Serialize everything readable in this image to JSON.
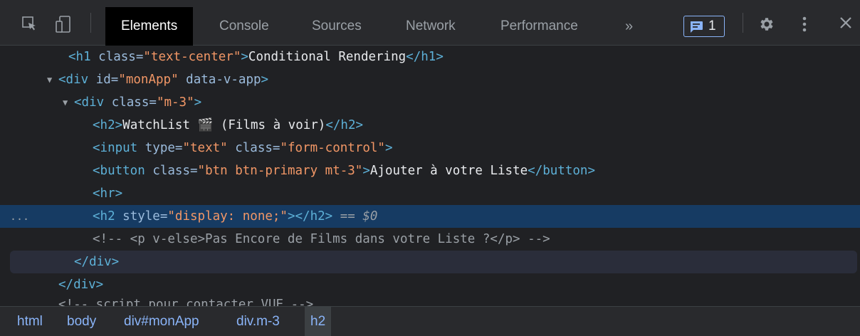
{
  "toolbar": {
    "tabs": [
      {
        "label": "Elements",
        "active": true
      },
      {
        "label": "Console",
        "active": false
      },
      {
        "label": "Sources",
        "active": false
      },
      {
        "label": "Network",
        "active": false
      },
      {
        "label": "Performance",
        "active": false
      }
    ],
    "more_tabs": "»",
    "issues_count": "1",
    "icons": [
      "inspect-element-icon",
      "device-toolbar-icon",
      "message-icon",
      "gear-icon",
      "kebab-menu-icon",
      "close-icon"
    ],
    "accent_color": "#8ab4f8"
  },
  "tree": {
    "h1_open": "<h1",
    "h1_attr": "class",
    "h1_val": "\"text-center\"",
    "h1_text": "Conditional Rendering",
    "h1_close": "</h1>",
    "div_app_open": "<div",
    "div_app_attr": "id",
    "div_app_val": "\"monApp\"",
    "div_app_attr2": "data-v-app",
    "div_m3_open": "<div",
    "div_m3_attr": "class",
    "div_m3_val": "\"m-3\"",
    "h2_open": "<h2>",
    "h2_text": "WatchList 🎬 (Films à voir)",
    "h2_close": "</h2>",
    "input_open": "<input",
    "input_attr1": "type",
    "input_val1": "\"text\"",
    "input_attr2": "class",
    "input_val2": "\"form-control\"",
    "button_open": "<button",
    "button_attr": "class",
    "button_val": "\"btn btn-primary mt-3\"",
    "button_text": "Ajouter à votre Liste",
    "button_close": "</button>",
    "hr": "<hr>",
    "h2b_open": "<h2",
    "h2b_attr": "style",
    "h2b_val": "\"display: none;\"",
    "h2b_close": "</h2>",
    "selected_marker": "== $0",
    "comment1": "<!-- <p v-else>Pas Encore de Films dans votre Liste ?</p> -->",
    "div_close1": "</div>",
    "div_close2": "</div>",
    "comment2": "<!-- script pour contacter VUE -->",
    "ellipsis": "..."
  },
  "breadcrumb": [
    "html",
    "body",
    "div#monApp",
    "div.m-3",
    "h2"
  ]
}
